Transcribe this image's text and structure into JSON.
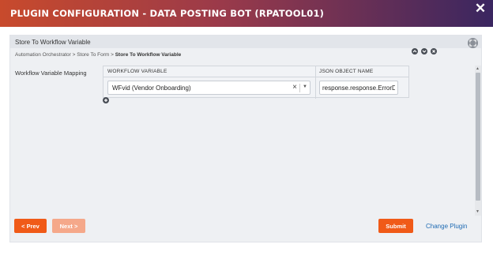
{
  "dialog": {
    "title": "PLUGIN CONFIGURATION - DATA POSTING BOT (RPATOOL01)",
    "close_glyph": "✕",
    "colors": {
      "title_gradient": [
        "#c84a2c",
        "#3a2660"
      ],
      "accent": "#f05a18",
      "link": "#1f6bb3"
    }
  },
  "panel": {
    "title": "Store To Workflow Variable",
    "expand_icon": "expand-icon"
  },
  "breadcrumb": {
    "path": "Automation Orchestrator > Store To Form > ",
    "current": "Store To Workflow Variable"
  },
  "mapping": {
    "label": "Workflow Variable Mapping",
    "columns": [
      "WORKFLOW VARIABLE",
      "JSON OBJECT NAME"
    ],
    "rows": [
      {
        "workflow_variable": "WFvid (Vendor Onboarding)",
        "json_object_name": "response.response.ErrorDe"
      }
    ],
    "clear_glyph": "×",
    "caret_glyph": "▼",
    "row_icons": [
      "move-up-icon",
      "move-down-icon",
      "remove-row-icon"
    ],
    "add_icon": "add-row-icon"
  },
  "footer": {
    "prev_label": "< Prev",
    "next_label": "Next >",
    "submit_label": "Submit",
    "change_plugin_label": "Change Plugin"
  }
}
